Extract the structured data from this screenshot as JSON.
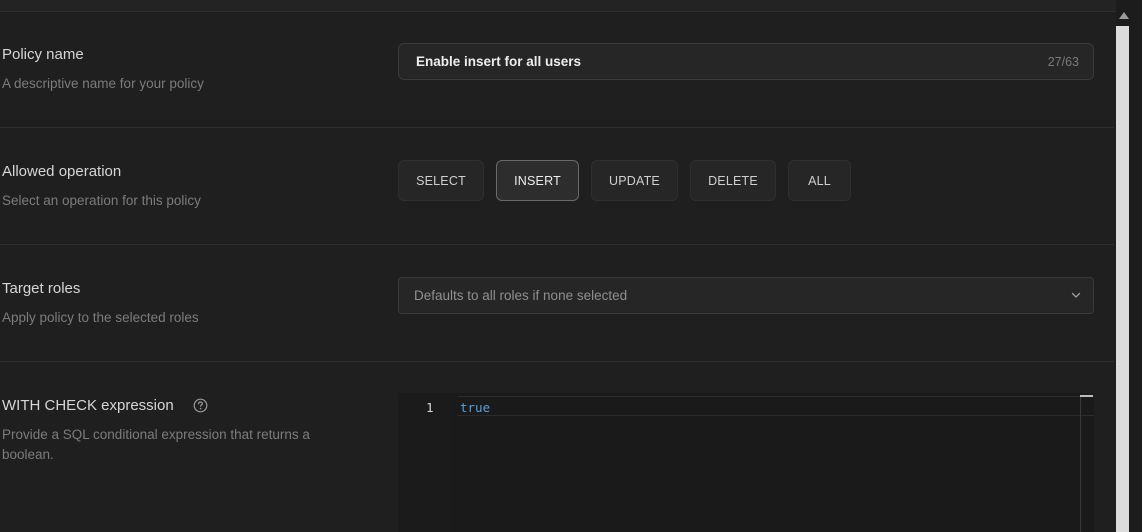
{
  "policy_name": {
    "label": "Policy name",
    "description": "A descriptive name for your policy",
    "value": "Enable insert for all users",
    "char_count": "27/63"
  },
  "allowed_operation": {
    "label": "Allowed operation",
    "description": "Select an operation for this policy",
    "options": [
      "SELECT",
      "INSERT",
      "UPDATE",
      "DELETE",
      "ALL"
    ],
    "selected": "INSERT"
  },
  "target_roles": {
    "label": "Target roles",
    "description": "Apply policy to the selected roles",
    "placeholder": "Defaults to all roles if none selected",
    "icon": "chevron-down-icon"
  },
  "with_check": {
    "label": "WITH CHECK expression",
    "description": "Provide a SQL conditional expression that returns a boolean.",
    "help_icon": "question-circle-icon",
    "editor": {
      "line_number": "1",
      "code": "true"
    }
  },
  "colors": {
    "background": "#1f1f1f",
    "keyword": "#5a9fd6",
    "active_border": "#6a6a6a"
  }
}
